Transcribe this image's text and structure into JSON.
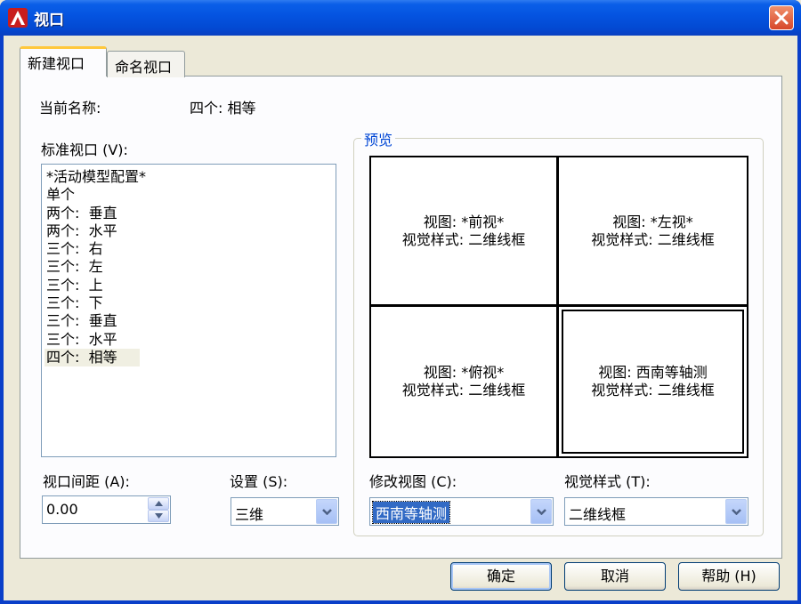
{
  "window": {
    "title": "视口"
  },
  "tabs": [
    {
      "label": "新建视口",
      "active": true
    },
    {
      "label": "命名视口",
      "active": false
    }
  ],
  "current_name": {
    "label": "当前名称:",
    "value": "四个:  相等"
  },
  "standard_viewports": {
    "label": "标准视口 (V):",
    "items": [
      "*活动模型配置*",
      "单个",
      "两个:  垂直",
      "两个:  水平",
      "三个:  右",
      "三个:  左",
      "三个:  上",
      "三个:  下",
      "三个:  垂直",
      "三个:  水平",
      "四个:  相等"
    ],
    "selected_index": 10
  },
  "preview": {
    "legend": "预览",
    "panes": [
      {
        "view": "视图: *前视*",
        "style": "视觉样式: 二维线框",
        "selected": false
      },
      {
        "view": "视图: *左视*",
        "style": "视觉样式: 二维线框",
        "selected": false
      },
      {
        "view": "视图: *俯视*",
        "style": "视觉样式: 二维线框",
        "selected": false
      },
      {
        "view": "视图: 西南等轴测",
        "style": "视觉样式: 二维线框",
        "selected": true
      }
    ]
  },
  "spacing": {
    "label": "视口间距 (A):",
    "value": "0.00"
  },
  "setup": {
    "label": "设置 (S):",
    "value": "三维"
  },
  "change_view": {
    "label": "修改视图 (C):",
    "value": "西南等轴测"
  },
  "visual_style": {
    "label": "视觉样式 (T):",
    "value": "二维线框"
  },
  "buttons": {
    "ok": "确定",
    "cancel": "取消",
    "help": "帮助 (H)"
  },
  "colors": {
    "titlebar": "#0453e0",
    "dialog_bg": "#ece9d8",
    "accent": "#0046d5",
    "selection": "#316ac5",
    "close": "#d7472a"
  },
  "icons": {
    "app": "autocad-icon",
    "close": "close-icon"
  }
}
